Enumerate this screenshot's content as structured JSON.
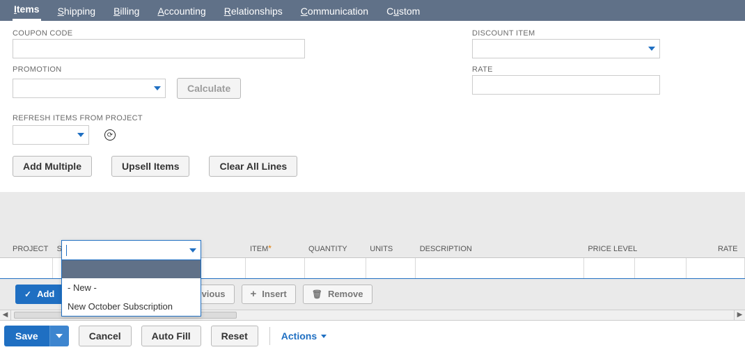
{
  "tabs": {
    "items": "Items",
    "shipping": "Shipping",
    "billing": "Billing",
    "accounting": "Accounting",
    "relationships": "Relationships",
    "communication": "Communication",
    "custom": "Custom"
  },
  "fields": {
    "coupon_label": "COUPON CODE",
    "coupon_value": "",
    "promotion_label": "PROMOTION",
    "promotion_value": "",
    "calculate_label": "Calculate",
    "discount_label": "DISCOUNT ITEM",
    "discount_value": "",
    "rate_label": "RATE",
    "rate_value": "",
    "refresh_label": "REFRESH ITEMS FROM PROJECT",
    "refresh_value": ""
  },
  "item_buttons": {
    "add_multiple": "Add Multiple",
    "upsell": "Upsell Items",
    "clear": "Clear All Lines"
  },
  "grid": {
    "headers": {
      "project": "PROJECT",
      "subscription": "SUBSCRIPTION",
      "item": "ITEM",
      "quantity": "QUANTITY",
      "units": "UNITS",
      "description": "DESCRIPTION",
      "price_level": "PRICE LEVEL",
      "rate": "RATE"
    },
    "line_buttons": {
      "add": "Add",
      "cancel_hidden_prev": "evious",
      "insert": "Insert",
      "remove": "Remove"
    }
  },
  "dropdown": {
    "options": {
      "new": "- New -",
      "oct": "New October Subscription"
    }
  },
  "footer": {
    "save": "Save",
    "cancel": "Cancel",
    "autofill": "Auto Fill",
    "reset": "Reset",
    "actions": "Actions"
  }
}
